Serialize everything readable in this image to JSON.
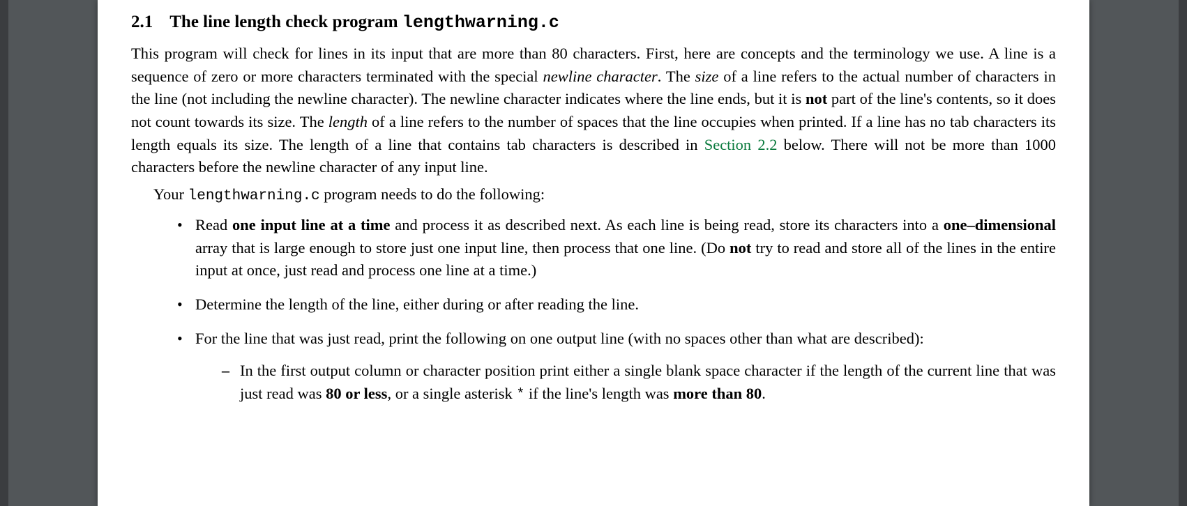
{
  "heading": {
    "number": "2.1",
    "title_prefix": "The line length check program ",
    "title_code": "lengthwarning.c"
  },
  "paragraph1": {
    "s1": "This program will check for lines in its input that are more than 80 characters. First, here are concepts and the terminology we use. A line is a sequence of zero or more characters terminated with the special ",
    "i1": "newline character",
    "s2": ". The ",
    "i2": "size",
    "s3": " of a line refers to the actual number of characters in the line (not including the newline character). The newline character indicates where the line ends, but it is ",
    "b1": "not",
    "s4": " part of the line's contents, so it does not count towards its size. The ",
    "i3": "length",
    "s5": " of a line refers to the number of spaces that the line occupies when printed. If a line has no tab characters its length equals its size. The length of a line that contains tab characters is described in ",
    "link": "Section 2.2",
    "s6": " below. There will not be more than 1000 characters before the newline character of any input line."
  },
  "paragraph2": {
    "s1": "Your ",
    "c1": "lengthwarning.c",
    "s2": " program needs to do the following:"
  },
  "bullets": {
    "b1": {
      "s1": "Read ",
      "bold1": "one input line at a time",
      "s2": " and process it as described next. As each line is being read, store its characters into a ",
      "bold2": "one–dimensional",
      "s3": " array that is large enough to store just one input line, then process that one line. (Do ",
      "bold3": "not",
      "s4": " try to read and store all of the lines in the entire input at once, just read and process one line at a time.)"
    },
    "b2": "Determine the length of the line, either during or after reading the line.",
    "b3": {
      "s1": "For the line that was just read, print the following on one output line (with no spaces other than what are described):",
      "dash1": {
        "s1": "In the first output column or character position print either a single blank space character if the length of the current line that was just read was ",
        "bold1": "80 or less",
        "s2": ", or a single asterisk ",
        "star": "*",
        "s3": " if the line's length was ",
        "bold2": "more than 80",
        "s4": "."
      }
    }
  }
}
